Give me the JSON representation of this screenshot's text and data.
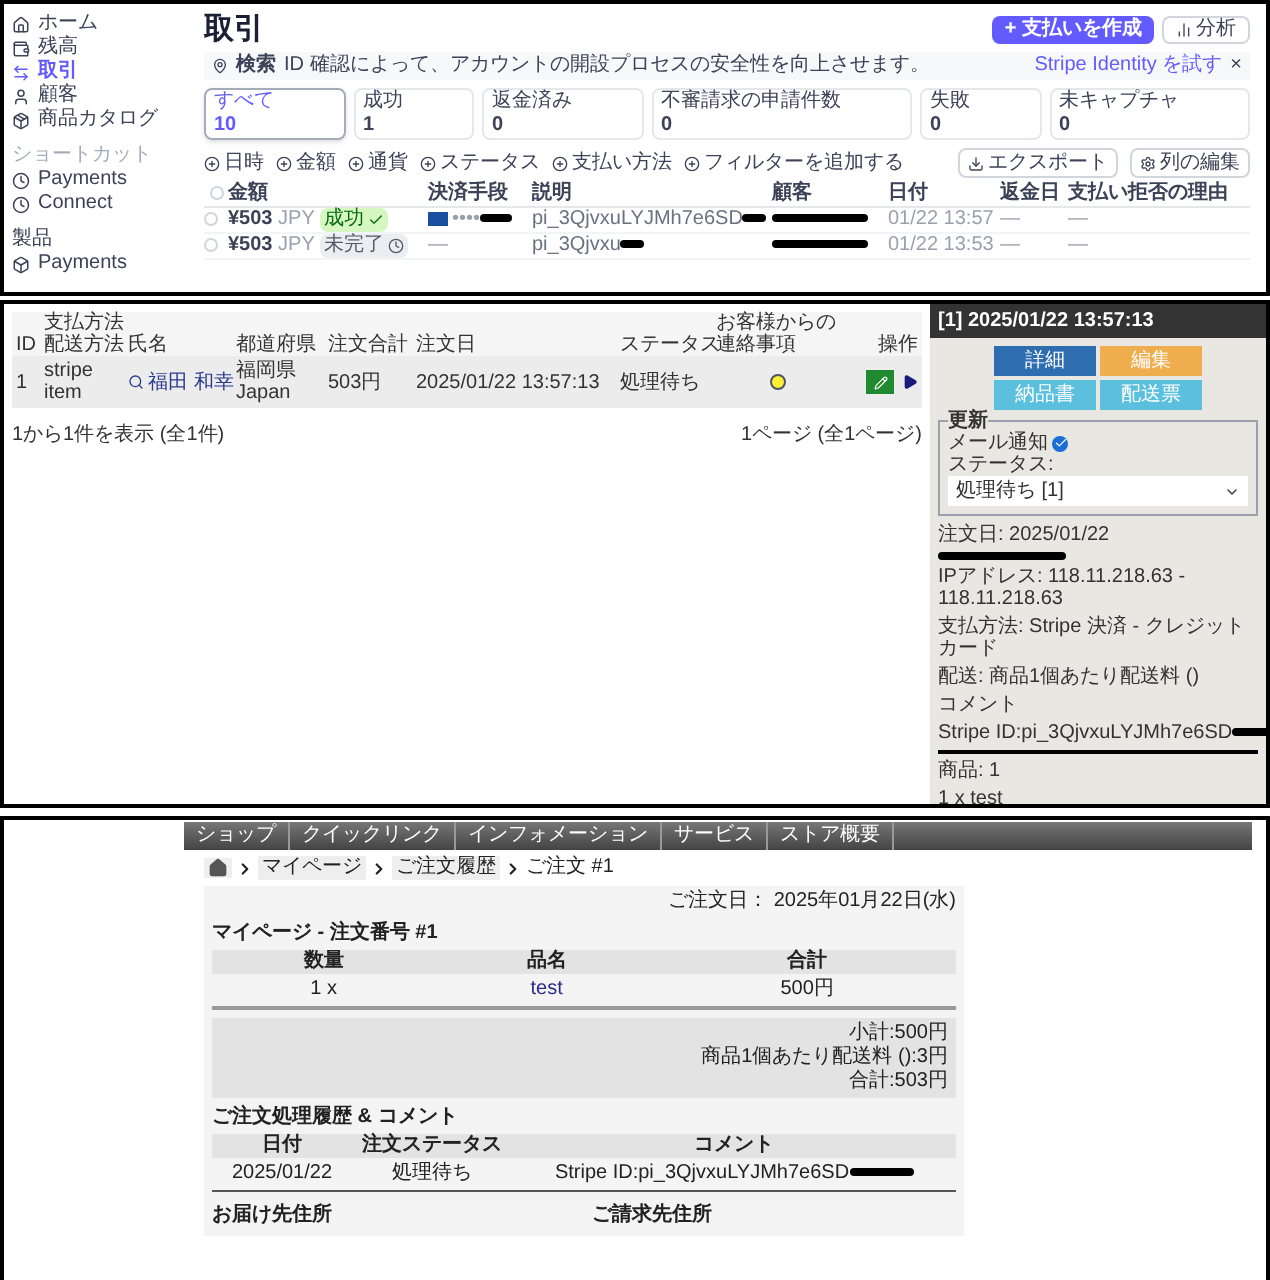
{
  "dashboard": {
    "sidebar": {
      "items": [
        {
          "label": "ホーム",
          "selected": false
        },
        {
          "label": "残高",
          "selected": false
        },
        {
          "label": "取引",
          "selected": true
        },
        {
          "label": "顧客",
          "selected": false
        },
        {
          "label": "商品カタログ",
          "selected": false
        }
      ],
      "section": "ショートカット",
      "shortcuts": [
        {
          "label": "Payments"
        },
        {
          "label": "Connect"
        }
      ],
      "section_2": "製品",
      "cut_item": "Payments"
    },
    "title": "取引",
    "create_button": "+ 支払いを作成",
    "analyze_button": "分析",
    "banner": {
      "tag": "検索",
      "text": "ID 確認によって、アカウントの開設プロセスの安全性を向上させます。",
      "link": "Stripe Identity を試す",
      "close": "×"
    },
    "status_tabs": [
      {
        "label": "すべて",
        "count": "10",
        "selected": true
      },
      {
        "label": "成功",
        "count": "1",
        "selected": false
      },
      {
        "label": "返金済み",
        "count": "0",
        "selected": false
      },
      {
        "label": "不審請求の申請件数",
        "count": "0",
        "selected": false
      },
      {
        "label": "失敗",
        "count": "0",
        "selected": false
      },
      {
        "label": "未キャプチャ",
        "count": "0",
        "selected": false
      }
    ],
    "filters": [
      "日時",
      "金額",
      "通貨",
      "ステータス",
      "支払い方法",
      "フィルターを追加する"
    ],
    "export_button": "エクスポート",
    "columns_button": "列の編集",
    "table": {
      "all_checked": false,
      "columns": [
        "金額",
        "決済手段",
        "説明",
        "顧客",
        "日付",
        "返金日",
        "支払い拒否の理由"
      ],
      "rows": [
        {
          "checked": false,
          "amount": "¥503",
          "currency": "JPY",
          "status": "成功",
          "kind": "succeeded",
          "method": "••••",
          "card": true,
          "description": "pi_3QjvxuLYJMh7e6SD",
          "date": "01/22 13:57",
          "refund": "—",
          "reason": "—"
        },
        {
          "checked": false,
          "amount": "¥503",
          "currency": "JPY",
          "status": "未完了",
          "kind": "incomplete",
          "method": "—",
          "card": false,
          "description": "pi_3Qjvxu",
          "date": "01/22 13:53",
          "refund": "—",
          "reason": "—"
        }
      ]
    }
  },
  "order_admin": {
    "columns": [
      {
        "lines": [
          "ID"
        ]
      },
      {
        "lines": [
          "支払方法",
          "配送方法"
        ]
      },
      {
        "lines": [
          "氏名"
        ]
      },
      {
        "lines": [
          "都道府県"
        ]
      },
      {
        "lines": [
          "注文合計"
        ]
      },
      {
        "lines": [
          "注文日"
        ]
      },
      {
        "lines": [
          "ステータス"
        ]
      },
      {
        "lines": [
          "お客様からの",
          "連絡事項"
        ]
      },
      {
        "lines": [
          "操作"
        ]
      }
    ],
    "row": {
      "id": "1",
      "payment": "stripe",
      "shipping": "item",
      "name": "福田 和幸",
      "prefecture": "福岡県",
      "country": "Japan",
      "total": "503円",
      "date": "2025/01/22 13:57:13",
      "status": "処理待ち",
      "has_note": true
    },
    "footer_left": "1から1件を表示 (全1件)",
    "footer_right": "1ページ (全1ページ)",
    "detail": {
      "header": "[1] 2025/01/22 13:57:13",
      "buttons": [
        {
          "label": "詳細",
          "color": "#2e6db0"
        },
        {
          "label": "編集",
          "color": "#f0ad4e"
        },
        {
          "label": "納品書",
          "color": "#5bc0de"
        },
        {
          "label": "配送票",
          "color": "#5bc0de"
        }
      ],
      "legend": "更新",
      "mail_label": "メール通知",
      "mail_checked": true,
      "status_label": "ステータス:",
      "status_value": "処理待ち [1]",
      "order_date": "注文日: 2025/01/22",
      "ip": "IPアドレス: 118.11.218.63 - 118.11.218.63",
      "payment": "支払方法: Stripe 決済 - クレジットカード",
      "shipping": "配送: 商品1個あたり配送料 ()",
      "comment_label": "コメント",
      "stripe_id": "Stripe ID:pi_3QjvxuLYJMh7e6SD",
      "items": "商品: 1",
      "item_line": "1 x test"
    }
  },
  "storefront": {
    "menu": [
      "ショップ",
      "クイックリンク",
      "インフォメーション",
      "サービス",
      "ストア概要"
    ],
    "breadcrumb": [
      "マイページ",
      "ご注文履歴",
      "ご注文 #1"
    ],
    "order_date": "ご注文日： 2025年01月22日(水)",
    "title": "マイページ - 注文番号 #1",
    "items_table": {
      "columns": [
        "数量",
        "品名",
        "合計"
      ],
      "rows": [
        {
          "qty": "1 x",
          "name": "test",
          "total": "500円"
        }
      ]
    },
    "totals": [
      "小計:500円",
      "商品1個あたり配送料 ():3円",
      "合計:503円"
    ],
    "history_title": "ご注文処理履歴 & コメント",
    "history_table": {
      "columns": [
        "日付",
        "注文ステータス",
        "コメント"
      ],
      "rows": [
        {
          "date": "2025/01/22",
          "status": "処理待ち",
          "comment": "Stripe ID:pi_3QjvxuLYJMh7e6SD"
        }
      ]
    },
    "shipping_address": "お届け先住所",
    "billing_address": "ご請求先住所"
  }
}
